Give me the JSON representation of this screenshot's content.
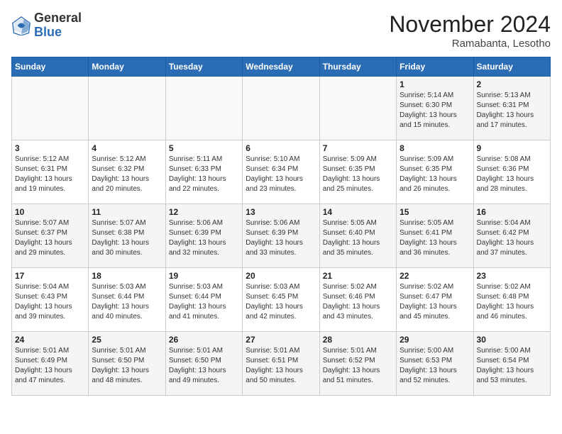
{
  "header": {
    "logo_general": "General",
    "logo_blue": "Blue",
    "month_title": "November 2024",
    "location": "Ramabanta, Lesotho"
  },
  "days_of_week": [
    "Sunday",
    "Monday",
    "Tuesday",
    "Wednesday",
    "Thursday",
    "Friday",
    "Saturday"
  ],
  "weeks": [
    [
      {
        "day": "",
        "detail": ""
      },
      {
        "day": "",
        "detail": ""
      },
      {
        "day": "",
        "detail": ""
      },
      {
        "day": "",
        "detail": ""
      },
      {
        "day": "",
        "detail": ""
      },
      {
        "day": "1",
        "detail": "Sunrise: 5:14 AM\nSunset: 6:30 PM\nDaylight: 13 hours\nand 15 minutes."
      },
      {
        "day": "2",
        "detail": "Sunrise: 5:13 AM\nSunset: 6:31 PM\nDaylight: 13 hours\nand 17 minutes."
      }
    ],
    [
      {
        "day": "3",
        "detail": "Sunrise: 5:12 AM\nSunset: 6:31 PM\nDaylight: 13 hours\nand 19 minutes."
      },
      {
        "day": "4",
        "detail": "Sunrise: 5:12 AM\nSunset: 6:32 PM\nDaylight: 13 hours\nand 20 minutes."
      },
      {
        "day": "5",
        "detail": "Sunrise: 5:11 AM\nSunset: 6:33 PM\nDaylight: 13 hours\nand 22 minutes."
      },
      {
        "day": "6",
        "detail": "Sunrise: 5:10 AM\nSunset: 6:34 PM\nDaylight: 13 hours\nand 23 minutes."
      },
      {
        "day": "7",
        "detail": "Sunrise: 5:09 AM\nSunset: 6:35 PM\nDaylight: 13 hours\nand 25 minutes."
      },
      {
        "day": "8",
        "detail": "Sunrise: 5:09 AM\nSunset: 6:35 PM\nDaylight: 13 hours\nand 26 minutes."
      },
      {
        "day": "9",
        "detail": "Sunrise: 5:08 AM\nSunset: 6:36 PM\nDaylight: 13 hours\nand 28 minutes."
      }
    ],
    [
      {
        "day": "10",
        "detail": "Sunrise: 5:07 AM\nSunset: 6:37 PM\nDaylight: 13 hours\nand 29 minutes."
      },
      {
        "day": "11",
        "detail": "Sunrise: 5:07 AM\nSunset: 6:38 PM\nDaylight: 13 hours\nand 30 minutes."
      },
      {
        "day": "12",
        "detail": "Sunrise: 5:06 AM\nSunset: 6:39 PM\nDaylight: 13 hours\nand 32 minutes."
      },
      {
        "day": "13",
        "detail": "Sunrise: 5:06 AM\nSunset: 6:39 PM\nDaylight: 13 hours\nand 33 minutes."
      },
      {
        "day": "14",
        "detail": "Sunrise: 5:05 AM\nSunset: 6:40 PM\nDaylight: 13 hours\nand 35 minutes."
      },
      {
        "day": "15",
        "detail": "Sunrise: 5:05 AM\nSunset: 6:41 PM\nDaylight: 13 hours\nand 36 minutes."
      },
      {
        "day": "16",
        "detail": "Sunrise: 5:04 AM\nSunset: 6:42 PM\nDaylight: 13 hours\nand 37 minutes."
      }
    ],
    [
      {
        "day": "17",
        "detail": "Sunrise: 5:04 AM\nSunset: 6:43 PM\nDaylight: 13 hours\nand 39 minutes."
      },
      {
        "day": "18",
        "detail": "Sunrise: 5:03 AM\nSunset: 6:44 PM\nDaylight: 13 hours\nand 40 minutes."
      },
      {
        "day": "19",
        "detail": "Sunrise: 5:03 AM\nSunset: 6:44 PM\nDaylight: 13 hours\nand 41 minutes."
      },
      {
        "day": "20",
        "detail": "Sunrise: 5:03 AM\nSunset: 6:45 PM\nDaylight: 13 hours\nand 42 minutes."
      },
      {
        "day": "21",
        "detail": "Sunrise: 5:02 AM\nSunset: 6:46 PM\nDaylight: 13 hours\nand 43 minutes."
      },
      {
        "day": "22",
        "detail": "Sunrise: 5:02 AM\nSunset: 6:47 PM\nDaylight: 13 hours\nand 45 minutes."
      },
      {
        "day": "23",
        "detail": "Sunrise: 5:02 AM\nSunset: 6:48 PM\nDaylight: 13 hours\nand 46 minutes."
      }
    ],
    [
      {
        "day": "24",
        "detail": "Sunrise: 5:01 AM\nSunset: 6:49 PM\nDaylight: 13 hours\nand 47 minutes."
      },
      {
        "day": "25",
        "detail": "Sunrise: 5:01 AM\nSunset: 6:50 PM\nDaylight: 13 hours\nand 48 minutes."
      },
      {
        "day": "26",
        "detail": "Sunrise: 5:01 AM\nSunset: 6:50 PM\nDaylight: 13 hours\nand 49 minutes."
      },
      {
        "day": "27",
        "detail": "Sunrise: 5:01 AM\nSunset: 6:51 PM\nDaylight: 13 hours\nand 50 minutes."
      },
      {
        "day": "28",
        "detail": "Sunrise: 5:01 AM\nSunset: 6:52 PM\nDaylight: 13 hours\nand 51 minutes."
      },
      {
        "day": "29",
        "detail": "Sunrise: 5:00 AM\nSunset: 6:53 PM\nDaylight: 13 hours\nand 52 minutes."
      },
      {
        "day": "30",
        "detail": "Sunrise: 5:00 AM\nSunset: 6:54 PM\nDaylight: 13 hours\nand 53 minutes."
      }
    ]
  ]
}
